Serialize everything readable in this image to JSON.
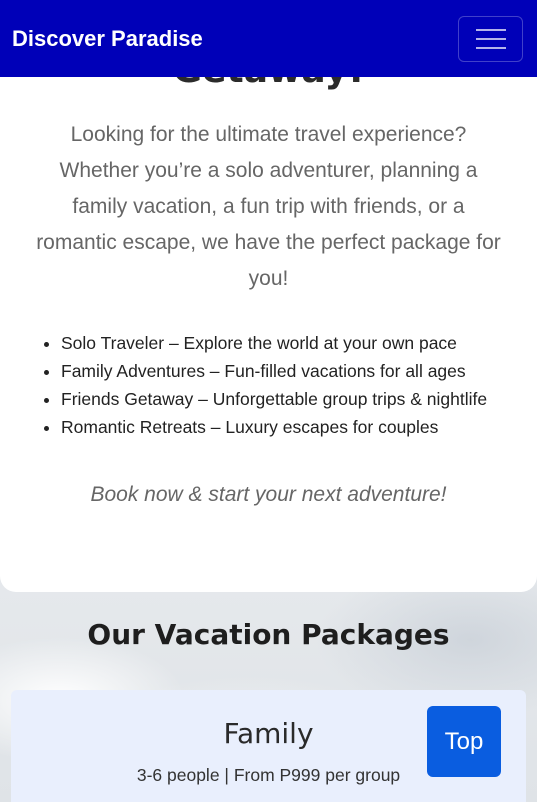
{
  "navbar": {
    "brand": "Discover Paradise",
    "toggler_icon": "hamburger-menu-icon"
  },
  "hero": {
    "heading_tail": "Getaway!",
    "intro": "Looking for the ultimate travel experience? Whether you’re a solo adventurer, planning a family vacation, a fun trip with friends, or a romantic escape, we have the perfect package for you!",
    "features": [
      "Solo Traveler – Explore the world at your own pace",
      "Family Adventures – Fun-filled vacations for all ages",
      "Friends Getaway – Unforgettable group trips & nightlife",
      "Romantic Retreats – Luxury escapes for couples"
    ],
    "cta": "Book now & start your next adventure!"
  },
  "packages": {
    "title": "Our Vacation Packages",
    "items": [
      {
        "name": "Family",
        "info": "3-6 people | From P999 per group"
      }
    ]
  },
  "top_button": {
    "label": "Top"
  },
  "colors": {
    "navbar_bg": "#0000b8",
    "top_button_bg": "#0a5de0",
    "package_card_bg": "#e9effd"
  }
}
